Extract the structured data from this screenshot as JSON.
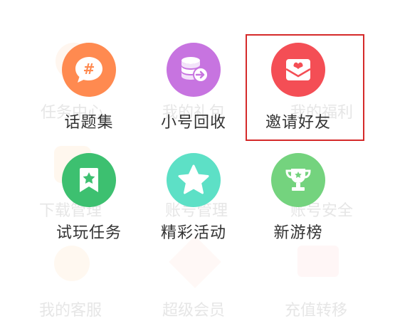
{
  "background_menu": {
    "labels": [
      "任务中心",
      "我的礼包",
      "我的福利",
      "下载管理",
      "账号管理",
      "账号安全",
      "我的客服",
      "超级会员",
      "充值转移"
    ]
  },
  "menu": {
    "items": [
      {
        "label": "话题集",
        "icon": "hashtag-chat-icon",
        "color": "#FF8A50"
      },
      {
        "label": "小号回收",
        "icon": "coin-stack-icon",
        "color": "#C774E0"
      },
      {
        "label": "邀请好友",
        "icon": "envelope-heart-icon",
        "color": "#F44E55"
      },
      {
        "label": "试玩任务",
        "icon": "bookmark-star-icon",
        "color": "#3DC070"
      },
      {
        "label": "精彩活动",
        "icon": "star-icon",
        "color": "#5DE0C6"
      },
      {
        "label": "新游榜",
        "icon": "trophy-icon",
        "color": "#74D37E"
      }
    ]
  },
  "highlight": {
    "target": "邀请好友",
    "color": "#D52A2A"
  }
}
